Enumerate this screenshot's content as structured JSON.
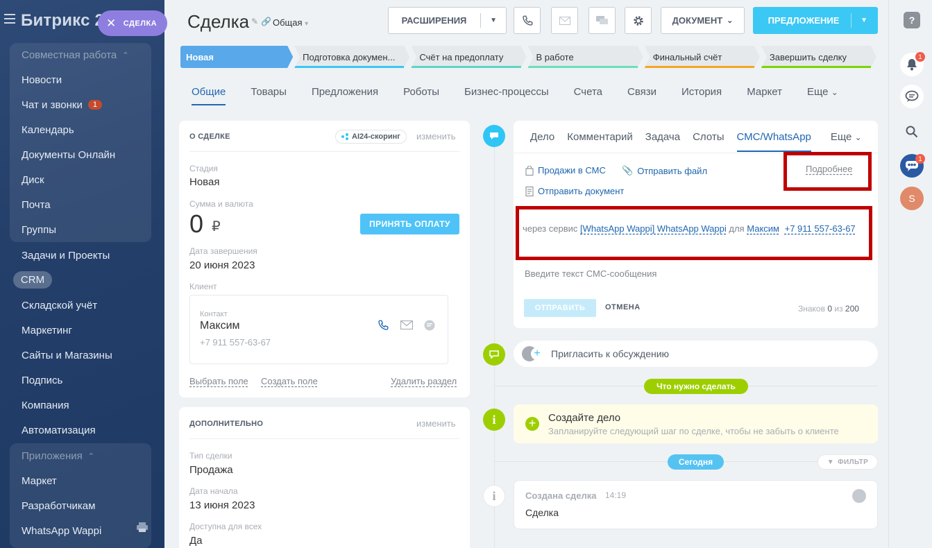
{
  "sidebar": {
    "brand": "Битрикс 2",
    "deal_pill": "СДЕЛКА",
    "group1_title": "Совместная работа",
    "items1": [
      "Новости",
      "Чат и звонки",
      "Календарь",
      "Документы Онлайн",
      "Диск",
      "Почта",
      "Группы"
    ],
    "chat_badge": "1",
    "items2": [
      "Задачи и Проекты",
      "CRM",
      "Складской учёт",
      "Маркетинг",
      "Сайты и Магазины",
      "Подпись",
      "Компания",
      "Автоматизация"
    ],
    "group2_title": "Приложения",
    "items3": [
      "Маркет",
      "Разработчикам",
      "WhatsApp Wappi"
    ]
  },
  "header": {
    "title": "Сделка",
    "category": "Общая",
    "extensions_label": "РАСШИРЕНИЯ",
    "document_label": "ДОКУМЕНТ",
    "offer_label": "ПРЕДЛОЖЕНИЕ"
  },
  "stages": [
    {
      "label": "Новая",
      "color": "#58a8ea"
    },
    {
      "label": "Подготовка докумен...",
      "color": "#39c7f4"
    },
    {
      "label": "Счёт на предоплату",
      "color": "#5fd3c4"
    },
    {
      "label": "В работе",
      "color": "#69e0b8"
    },
    {
      "label": "Финальный счёт",
      "color": "#f5a623"
    },
    {
      "label": "Завершить сделку",
      "color": "#7bd500"
    }
  ],
  "tabs": [
    "Общие",
    "Товары",
    "Предложения",
    "Роботы",
    "Бизнес-процессы",
    "Счета",
    "Связи",
    "История",
    "Маркет",
    "Еще"
  ],
  "about": {
    "title": "О СДЕЛКЕ",
    "ai_badge": "AI24-скоринг",
    "edit": "изменить",
    "stage_label": "Стадия",
    "stage_value": "Новая",
    "sum_label": "Сумма и валюта",
    "sum_value": "0",
    "currency": "₽",
    "pay_button": "ПРИНЯТЬ ОПЛАТУ",
    "close_date_label": "Дата завершения",
    "close_date_value": "20 июня 2023",
    "client_label": "Клиент",
    "contact_label": "Контакт",
    "contact_name": "Максим",
    "contact_phone": "+7 911 557-63-67",
    "select_field": "Выбрать поле",
    "create_field": "Создать поле",
    "delete_section": "Удалить раздел"
  },
  "extra": {
    "title": "ДОПОЛНИТЕЛЬНО",
    "edit": "изменить",
    "type_label": "Тип сделки",
    "type_value": "Продажа",
    "start_label": "Дата начала",
    "start_value": "13 июня 2023",
    "avail_label": "Доступна для всех",
    "avail_value": "Да"
  },
  "editor": {
    "tabs": [
      "Дело",
      "Комментарий",
      "Задача",
      "Слоты",
      "СМС/WhatsApp",
      "Еще"
    ],
    "sales_sms": "Продажи в СМС",
    "send_file": "Отправить файл",
    "send_doc": "Отправить документ",
    "more": "Подробнее",
    "via": "через сервис",
    "service": "[WhatsApp Wappi] WhatsApp Wappi",
    "for": "для",
    "recipient": "Максим",
    "phone": "+7 911 557-63-67",
    "placeholder": "Введите текст СМС-сообщения",
    "send": "ОТПРАВИТЬ",
    "cancel": "ОТМЕНА",
    "chars_label": "Знаков",
    "chars_count": "0",
    "chars_of": "из",
    "chars_max": "200"
  },
  "timeline": {
    "invite": "Пригласить к обсуждению",
    "todo_pill": "Что нужно сделать",
    "todo_title": "Создайте дело",
    "todo_hint": "Запланируйте следующий шаг по сделке, чтобы не забыть о клиенте",
    "today_pill": "Сегодня",
    "filter": "ФИЛЬТР",
    "event_title": "Создана сделка",
    "event_time": "14:19",
    "event_body": "Сделка"
  },
  "rightbar": {
    "help": "?",
    "notif_badge": "1",
    "chat_badge": "1",
    "avatar_letter": "S"
  },
  "colors": {
    "accent": "#2067b0",
    "primary_button": "#3bc8f5",
    "highlight_box": "#c00000",
    "sidebar_bg": "#243f6a"
  }
}
